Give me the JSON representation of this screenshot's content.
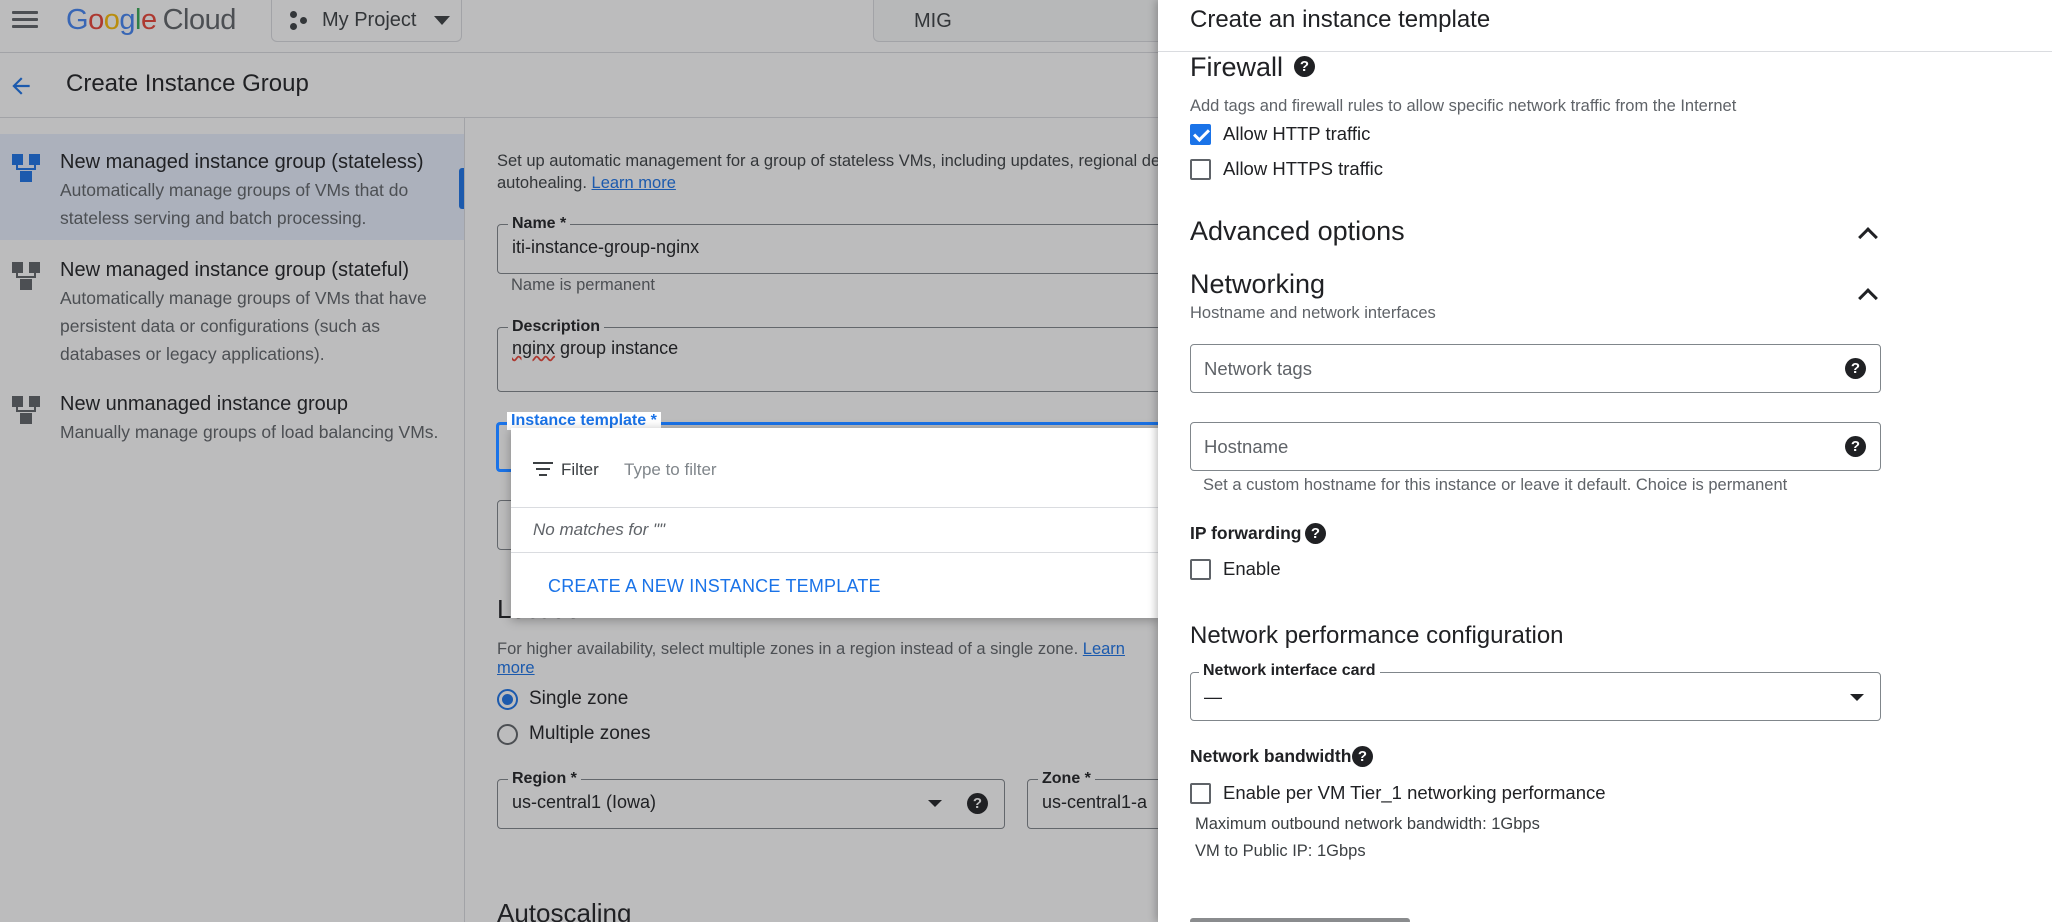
{
  "topbar": {
    "logo_google": "Google",
    "logo_cloud": "Cloud",
    "project": "My Project",
    "search_value": "MIG"
  },
  "page": {
    "title": "Create Instance Group"
  },
  "leftnav": {
    "items": [
      {
        "title": "New managed instance group (stateless)",
        "desc": "Automatically manage groups of VMs that do stateless serving and batch processing.",
        "active": true
      },
      {
        "title": "New managed instance group (stateful)",
        "desc": "Automatically manage groups of VMs that have persistent data or configurations (such as databases or legacy applications).",
        "active": false
      },
      {
        "title": "New unmanaged instance group",
        "desc": "Manually manage groups of load balancing VMs.",
        "active": false
      }
    ]
  },
  "main": {
    "intro": "Set up automatic management for a group of stateless VMs, including updates, regional dep",
    "intro_line2": "autohealing.",
    "learn_more": "Learn more",
    "name_label": "Name *",
    "name_value": "iti-instance-group-nginx",
    "name_hint": "Name is permanent",
    "desc_label": "Description",
    "desc_value_underlined": "nginx",
    "desc_value_rest": " group instance",
    "template_label": "Instance template *",
    "location_title": "Location",
    "location_hint": "For higher availability, select multiple zones in a region instead of a single zone.",
    "location_learn_more": "Learn more",
    "zone_options": [
      "Single zone",
      "Multiple zones"
    ],
    "region_label": "Region *",
    "region_value": "us-central1 (Iowa)",
    "zone_label": "Zone *",
    "zone_value": "us-central1-a",
    "autoscaling_title": "Autoscaling"
  },
  "dropdown": {
    "filter_label": "Filter",
    "filter_placeholder": "Type to filter",
    "no_matches": "No matches for \"\"",
    "create_action": "CREATE A NEW INSTANCE TEMPLATE"
  },
  "panel": {
    "title": "Create an instance template",
    "firewall": {
      "title": "Firewall",
      "subtitle": "Add tags and firewall rules to allow specific network traffic from the Internet",
      "http_label": "Allow HTTP traffic",
      "http_checked": true,
      "https_label": "Allow HTTPS traffic",
      "https_checked": false
    },
    "advanced_title": "Advanced options",
    "networking": {
      "title": "Networking",
      "subtitle": "Hostname and network interfaces",
      "tags_placeholder": "Network tags",
      "hostname_placeholder": "Hostname",
      "hostname_hint": "Set a custom hostname for this instance or leave it default. Choice is permanent",
      "ip_forwarding_label": "IP forwarding",
      "ip_forwarding_enable": "Enable"
    },
    "perf": {
      "title": "Network performance configuration",
      "nic_label": "Network interface card",
      "nic_value": "—",
      "bandwidth_label": "Network bandwidth",
      "tier1_label": "Enable per VM Tier_1 networking performance",
      "max_outbound": "Maximum outbound network bandwidth: 1Gbps",
      "vm_public": "VM to Public IP: 1Gbps"
    },
    "help_glyph": "?"
  },
  "colors": {
    "accent": "#1a73e8",
    "text": "#202124",
    "muted": "#5f6368",
    "border": "#dadce0"
  }
}
